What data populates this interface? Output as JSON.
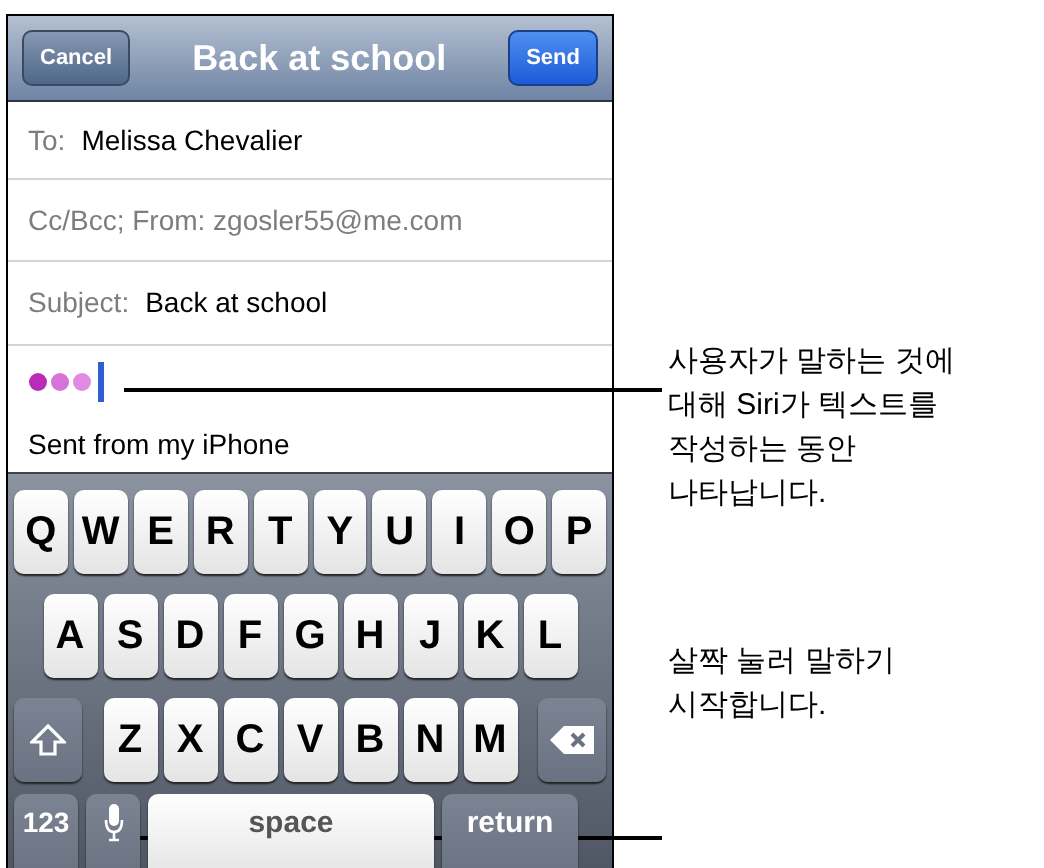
{
  "nav_bar": {
    "cancel": "Cancel",
    "title": "Back at school",
    "send": "Send"
  },
  "fields": [
    {
      "label": "To:",
      "value": "Melissa Chevalier"
    },
    {
      "label": "Cc/Bcc; From: zgosler55@me.com"
    },
    {
      "label": "Subject:",
      "value": "Back at school"
    }
  ],
  "body": {
    "signature": "Sent from my iPhone"
  },
  "keyboard": {
    "rows": [
      {
        "keys": [
          {
            "kind": "letter",
            "label": "Q"
          },
          {
            "kind": "letter",
            "label": "W"
          },
          {
            "kind": "letter",
            "label": "E"
          },
          {
            "kind": "letter",
            "label": "R"
          },
          {
            "kind": "letter",
            "label": "T"
          },
          {
            "kind": "letter",
            "label": "Y"
          },
          {
            "kind": "letter",
            "label": "U"
          },
          {
            "kind": "letter",
            "label": "I"
          },
          {
            "kind": "letter",
            "label": "O"
          },
          {
            "kind": "letter",
            "label": "P"
          }
        ]
      },
      {
        "keys": [
          {
            "kind": "letter",
            "label": "A"
          },
          {
            "kind": "letter",
            "label": "S"
          },
          {
            "kind": "letter",
            "label": "D"
          },
          {
            "kind": "letter",
            "label": "F"
          },
          {
            "kind": "letter",
            "label": "G"
          },
          {
            "kind": "letter",
            "label": "H"
          },
          {
            "kind": "letter",
            "label": "J"
          },
          {
            "kind": "letter",
            "label": "K"
          },
          {
            "kind": "letter",
            "label": "L"
          }
        ]
      },
      {
        "keys": [
          {
            "kind": "shift"
          },
          {
            "kind": "letter",
            "label": "Z"
          },
          {
            "kind": "letter",
            "label": "X"
          },
          {
            "kind": "letter",
            "label": "C"
          },
          {
            "kind": "letter",
            "label": "V"
          },
          {
            "kind": "letter",
            "label": "B"
          },
          {
            "kind": "letter",
            "label": "N"
          },
          {
            "kind": "letter",
            "label": "M"
          },
          {
            "kind": "delete"
          }
        ]
      },
      {
        "keys": [
          {
            "kind": "numbers",
            "label": "123"
          },
          {
            "kind": "mic"
          },
          {
            "kind": "space",
            "label": "space"
          },
          {
            "kind": "return",
            "label": "return"
          }
        ]
      }
    ]
  },
  "callouts": [
    "사용자가 말하는 것에\n대해 Siri가 텍스트를\n작성하는 동안\n나타납니다.",
    "살짝 눌러 말하기\n시작합니다."
  ]
}
